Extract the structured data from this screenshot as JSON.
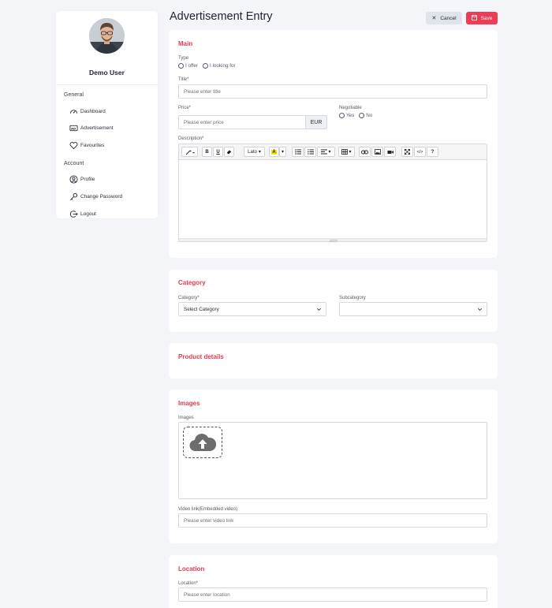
{
  "header": {
    "title": "Advertisement Entry",
    "cancel_label": "Cancel",
    "save_label": "Save"
  },
  "sidebar": {
    "user_name": "Demo User",
    "general_heading": "General",
    "account_heading": "Account",
    "general_items": [
      {
        "label": "Dashboard",
        "icon": "dashboard-icon"
      },
      {
        "label": "Advertisement",
        "icon": "advertisement-icon"
      },
      {
        "label": "Favourites",
        "icon": "heart-icon"
      }
    ],
    "account_items": [
      {
        "label": "Profile",
        "icon": "user-icon"
      },
      {
        "label": "Change Password",
        "icon": "key-icon"
      },
      {
        "label": "Logout",
        "icon": "logout-icon"
      }
    ]
  },
  "main": {
    "section_title": "Main",
    "type_label": "Type",
    "type_options": [
      "I offer",
      "I looking for"
    ],
    "title_label": "Title*",
    "title_placeholder": "Please enter title",
    "price_label": "Price*",
    "price_placeholder": "Please enter price",
    "currency": "EUR",
    "negotiable_label": "Negotiable",
    "negotiable_options": [
      "Yes",
      "No"
    ],
    "description_label": "Description*",
    "toolbar": {
      "font_name": "Lato"
    }
  },
  "category": {
    "section_title": "Category",
    "category_label": "Category*",
    "category_value": "Select Category",
    "subcategory_label": "Subcategory",
    "subcategory_value": ""
  },
  "product_details": {
    "section_title": "Product details"
  },
  "images": {
    "section_title": "Images",
    "images_label": "Images",
    "video_label": "Video link(Embedded video)",
    "video_placeholder": "Please enter video link"
  },
  "location": {
    "section_title": "Location",
    "location_label": "Location*",
    "location_placeholder": "Please enter location"
  },
  "colors": {
    "accent": "#e43a4f",
    "save_button": "#ee3c54",
    "background": "#f4f5f9"
  }
}
